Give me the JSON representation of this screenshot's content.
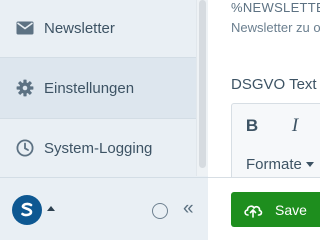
{
  "sidebar": {
    "items": [
      {
        "label": "Newsletter",
        "icon": "envelope-icon",
        "active": false
      },
      {
        "label": "Einstellungen",
        "icon": "gear-icon",
        "active": true
      },
      {
        "label": "System-Logging",
        "icon": "clock-icon",
        "active": false
      }
    ]
  },
  "footer": {
    "brand_icon": "brand-logo-icon",
    "circle_icon": "circle-icon",
    "collapse_label": "«"
  },
  "main": {
    "placeholder_text": "%NEWSLETTER",
    "description_text": "Newsletter zu o",
    "field_label": "DSGVO Text",
    "toolbar": {
      "bold_label": "B",
      "italic_label": "I",
      "formats_label": "Formate"
    }
  },
  "actions": {
    "save_label": "Save",
    "save_icon": "cloud-upload-icon"
  },
  "colors": {
    "sidebar_bg": "#e9eff4",
    "active_item_bg": "#dde6ee",
    "brand_blue": "#0e5892",
    "save_green": "#1e8e1e",
    "text": "#3d5364"
  }
}
